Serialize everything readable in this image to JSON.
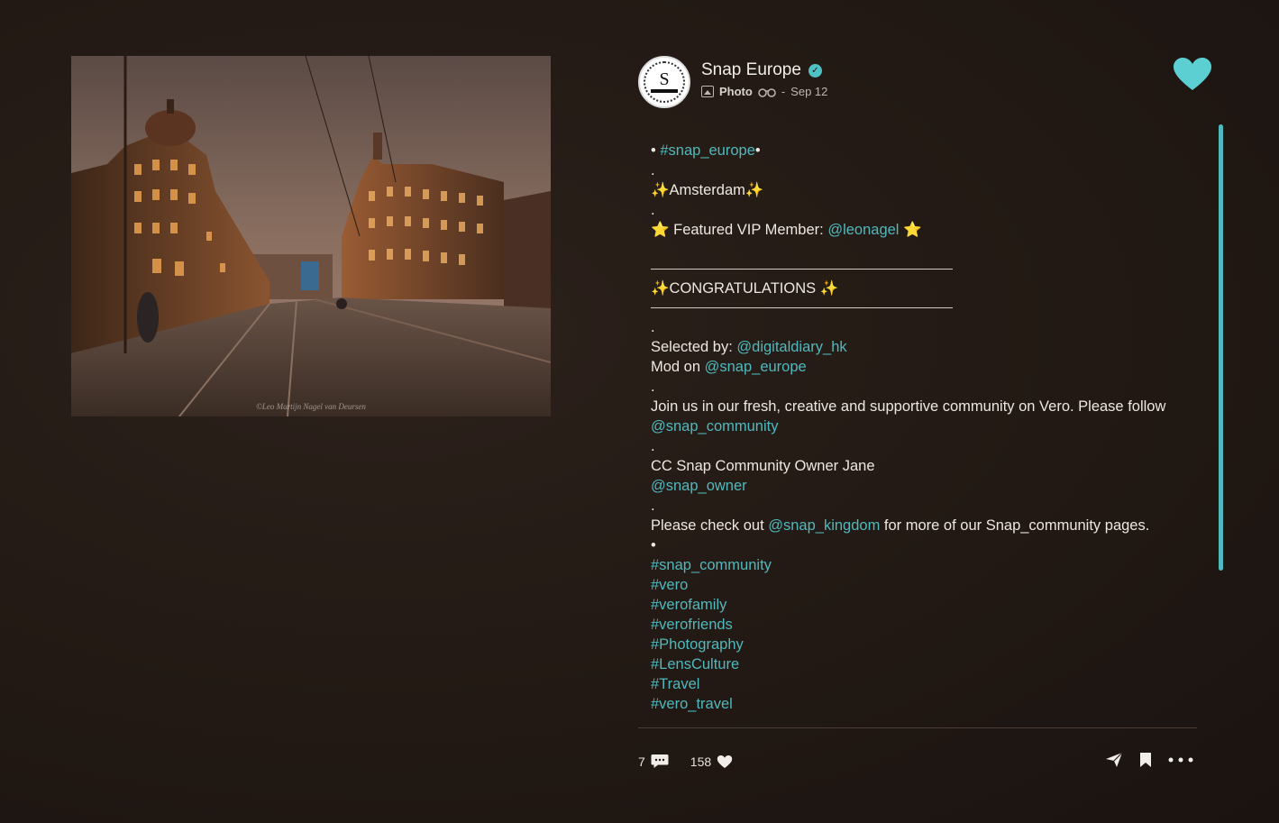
{
  "post": {
    "author": "Snap Europe",
    "verified_mark": "✓",
    "avatar_monogram": "S",
    "type": "Photo",
    "date": "Sep 12",
    "separator": "-",
    "photo_caption": "©Leo Martijn Nagel van Deursen"
  },
  "caption": {
    "l1_pre": "• ",
    "l1_tag": "#snap_europe",
    "l1_post": "•",
    "l2": ".",
    "l3": "✨Amsterdam✨",
    "l4": ".",
    "l5_pre": "⭐ Featured VIP Member: ",
    "l5_tag": "@leonagel",
    "l5_post": " ⭐",
    "l6": "✨CONGRATULATIONS ✨",
    "l7": ".",
    "l8_pre": "Selected by: ",
    "l8_tag": "@digitaldiary_hk",
    "l9_pre": "Mod on ",
    "l9_tag": "@snap_europe",
    "l10": ".",
    "l11_pre": "Join us in our fresh, creative and supportive community on Vero. Please follow ",
    "l11_tag": "@snap_community",
    "l12": ".",
    "l13": "CC Snap Community Owner Jane",
    "l14_tag": "@snap_owner",
    "l15": ".",
    "l16_pre": "Please check out ",
    "l16_tag": "@snap_kingdom",
    "l16_post": " for more of our Snap_community pages.",
    "l17": "•",
    "hashtags": [
      "#snap_community",
      "#vero",
      "#verofamily",
      "#verofriends",
      "#Photography",
      "#LensCulture",
      "#Travel",
      "#vero_travel"
    ]
  },
  "stats": {
    "comments": "7",
    "likes": "158"
  },
  "colors": {
    "accent": "#4fb9bd",
    "heart": "#5ccfd3",
    "background": "#221914"
  },
  "icons": [
    "verified-icon",
    "photo-type-icon",
    "binoculars-icon",
    "heart-icon",
    "comment-icon",
    "like-icon",
    "share-icon",
    "bookmark-icon",
    "more-icon"
  ]
}
